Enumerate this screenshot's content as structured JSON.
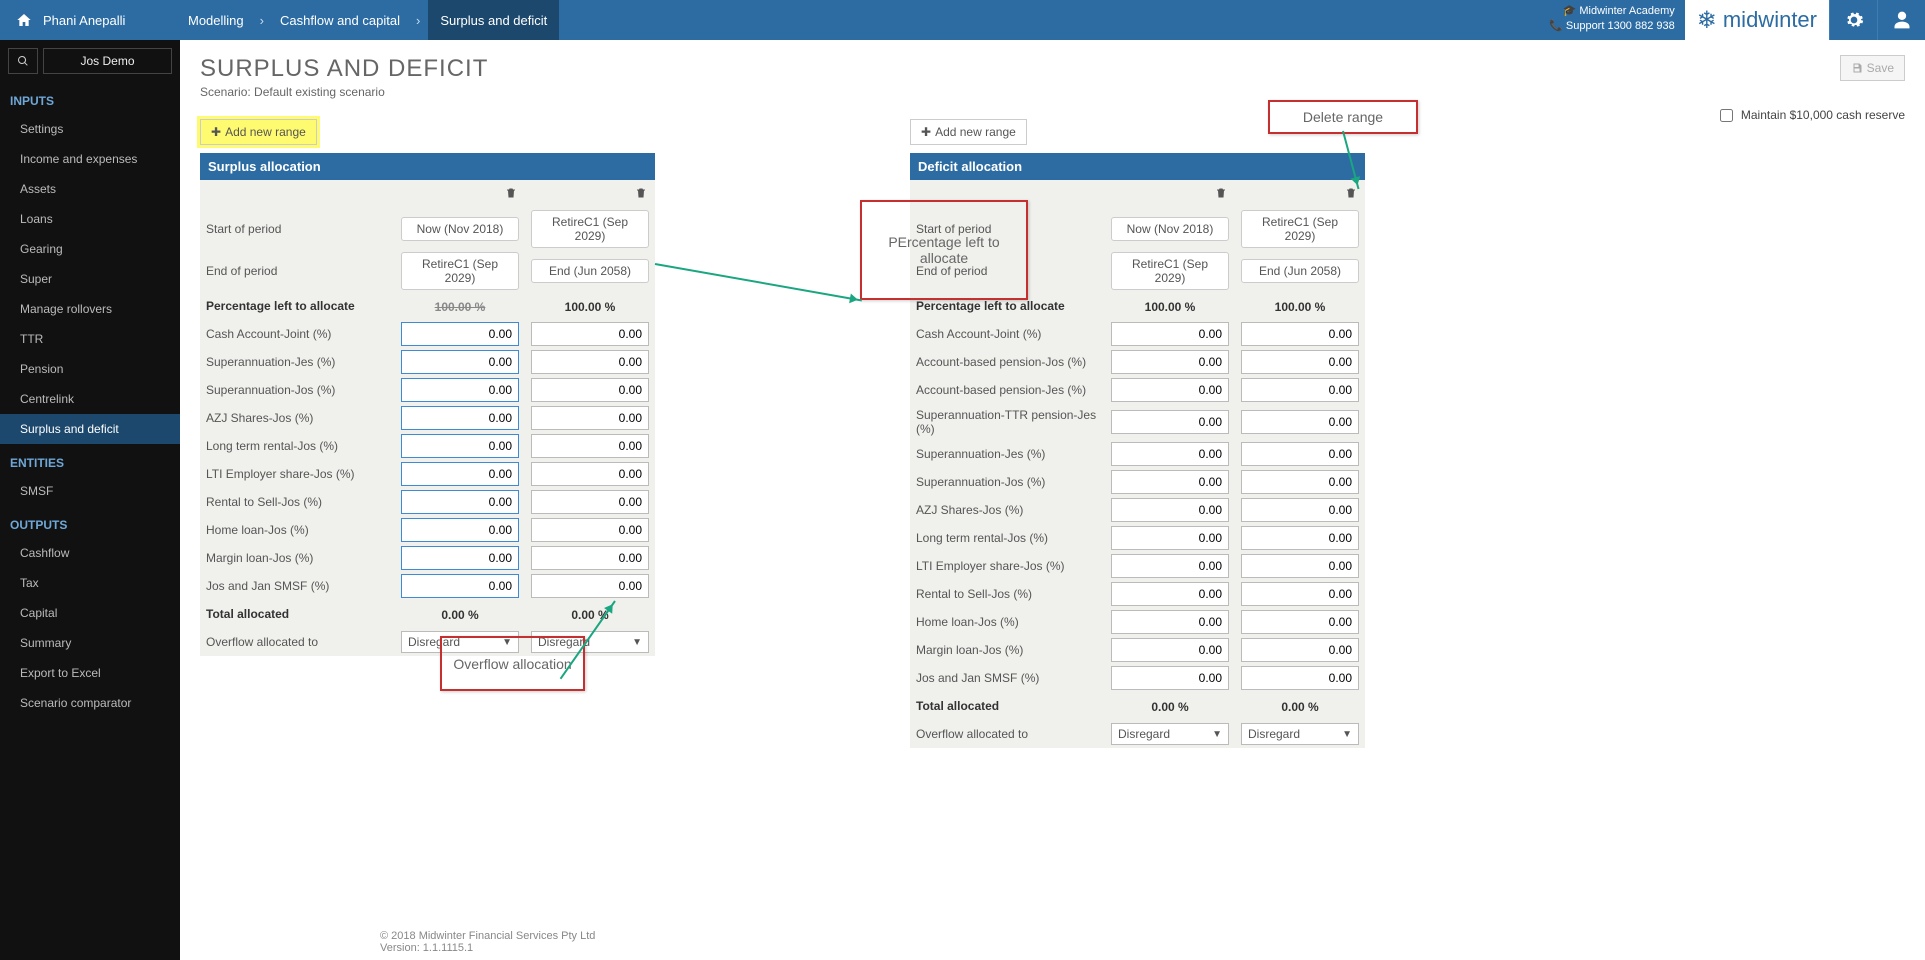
{
  "topbar": {
    "user": "Phani Anepalli",
    "crumbs": [
      "Modelling",
      "Cashflow and capital",
      "Surplus and deficit"
    ],
    "academy": "Midwinter Academy",
    "support": "Support 1300 882 938",
    "logo": "midwinter"
  },
  "sidebar": {
    "demo": "Jos Demo",
    "sections": [
      {
        "title": "INPUTS",
        "items": [
          "Settings",
          "Income and expenses",
          "Assets",
          "Loans",
          "Gearing",
          "Super",
          "Manage rollovers",
          "TTR",
          "Pension",
          "Centrelink",
          "Surplus and deficit"
        ],
        "active": "Surplus and deficit"
      },
      {
        "title": "ENTITIES",
        "items": [
          "SMSF"
        ]
      },
      {
        "title": "OUTPUTS",
        "items": [
          "Cashflow",
          "Tax",
          "Capital",
          "Summary",
          "Export to Excel",
          "Scenario comparator"
        ]
      }
    ]
  },
  "page": {
    "title": "SURPLUS AND DEFICIT",
    "scenario": "Scenario: Default existing scenario",
    "save": "Save",
    "maintain": "Maintain $10,000 cash reserve",
    "add_range": "Add new range"
  },
  "surplus": {
    "header": "Surplus allocation",
    "cols": [
      {
        "start": "Now (Nov 2018)",
        "end": "RetireC1 (Sep 2029)",
        "pct_left": "100.00 %",
        "total": "0.00 %",
        "overflow": "Disregard"
      },
      {
        "start": "RetireC1 (Sep 2029)",
        "end": "End (Jun 2058)",
        "pct_left": "100.00 %",
        "total": "0.00 %",
        "overflow": "Disregard"
      }
    ],
    "row_labels": {
      "start": "Start of period",
      "end": "End of period",
      "pct_left": "Percentage left to allocate",
      "total": "Total allocated",
      "overflow": "Overflow allocated to"
    },
    "rows": [
      "Cash Account-Joint (%)",
      "Superannuation-Jes (%)",
      "Superannuation-Jos (%)",
      "AZJ Shares-Jos (%)",
      "Long term rental-Jos (%)",
      "LTI Employer share-Jos (%)",
      "Rental to Sell-Jos (%)",
      "Home loan-Jos (%)",
      "Margin loan-Jos (%)",
      "Jos and Jan SMSF (%)"
    ],
    "val": "0.00"
  },
  "deficit": {
    "header": "Deficit allocation",
    "cols": [
      {
        "start": "Now (Nov 2018)",
        "end": "RetireC1 (Sep 2029)",
        "pct_left": "100.00 %",
        "total": "0.00 %",
        "overflow": "Disregard"
      },
      {
        "start": "RetireC1 (Sep 2029)",
        "end": "End (Jun 2058)",
        "pct_left": "100.00 %",
        "total": "0.00 %",
        "overflow": "Disregard"
      }
    ],
    "rows": [
      "Cash Account-Joint (%)",
      "Account-based pension-Jos (%)",
      "Account-based pension-Jes (%)",
      "Superannuation-TTR pension-Jes (%)",
      "Superannuation-Jes (%)",
      "Superannuation-Jos (%)",
      "AZJ Shares-Jos (%)",
      "Long term rental-Jos (%)",
      "LTI Employer share-Jos (%)",
      "Rental to Sell-Jos (%)",
      "Home loan-Jos (%)",
      "Margin loan-Jos (%)",
      "Jos and Jan SMSF (%)"
    ],
    "val": "0.00"
  },
  "annotations": {
    "delete": "Delete range",
    "pct": "PErcentage left to allocate",
    "overflow": "Overflow allocation"
  },
  "footer": {
    "copy": "© 2018 Midwinter Financial Services Pty Ltd",
    "ver": "Version: 1.1.1115.1"
  }
}
